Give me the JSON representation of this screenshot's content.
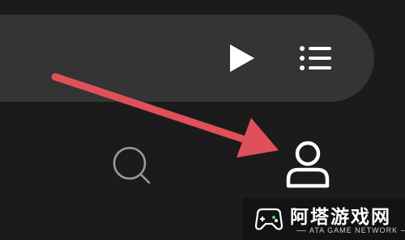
{
  "colors": {
    "background": "#1b1b1b",
    "now_playing_bar": "#343434",
    "icon_active": "#ffffff",
    "icon_inactive": "#9a9a9a",
    "annotation_arrow": "#e0505a"
  },
  "now_playing": {
    "controls": [
      {
        "name": "play-button",
        "icon": "play-icon"
      },
      {
        "name": "queue-button",
        "icon": "queue-list-icon"
      }
    ]
  },
  "bottom_nav": {
    "items": [
      {
        "name": "search",
        "icon": "search-icon",
        "active": false
      },
      {
        "name": "profile",
        "icon": "profile-icon",
        "active": true
      }
    ]
  },
  "annotation": {
    "icon": "arrow-icon",
    "points_to": "profile"
  },
  "watermark": {
    "title": "阿塔游戏网",
    "subtitle": "ATA GAME NETWORK",
    "icon": "gamepad-icon"
  }
}
